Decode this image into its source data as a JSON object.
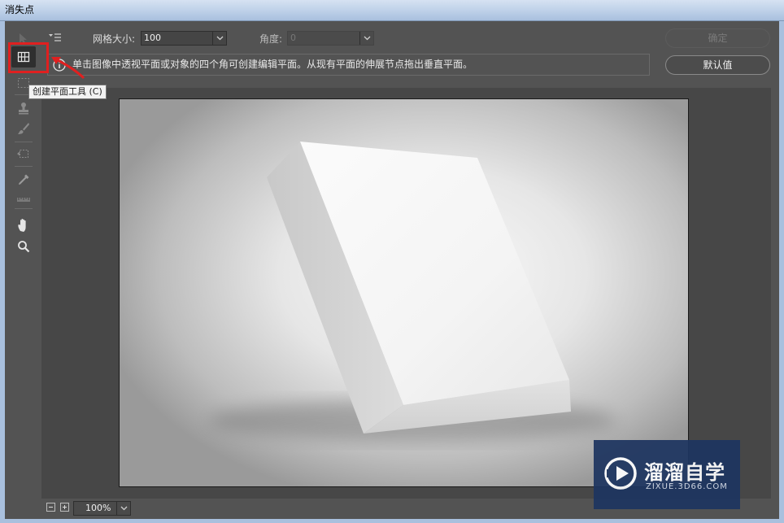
{
  "window": {
    "title": "消失点"
  },
  "tooltip": {
    "text": "创建平面工具 (C)"
  },
  "options": {
    "grid_size_label": "网格大小:",
    "grid_size_value": "100",
    "angle_label": "角度:",
    "angle_value": "0"
  },
  "buttons": {
    "ok": "确定",
    "default": "默认值"
  },
  "info": {
    "text": "单击图像中透视平面或对象的四个角可创建编辑平面。从现有平面的伸展节点拖出垂直平面。"
  },
  "status": {
    "zoom": "100%"
  },
  "watermark": {
    "main": "溜溜自学",
    "sub": "ZIXUE.3D66.COM"
  },
  "accent": {
    "highlight": "#e02020",
    "watermark_bg": "#1e3560"
  },
  "icons": [
    "edit-plane-icon",
    "create-plane-icon",
    "marquee-icon",
    "stamp-icon",
    "brush-icon",
    "transform-icon",
    "eyedropper-icon",
    "measure-icon",
    "hand-icon",
    "zoom-icon",
    "info-icon",
    "menu-icon"
  ]
}
